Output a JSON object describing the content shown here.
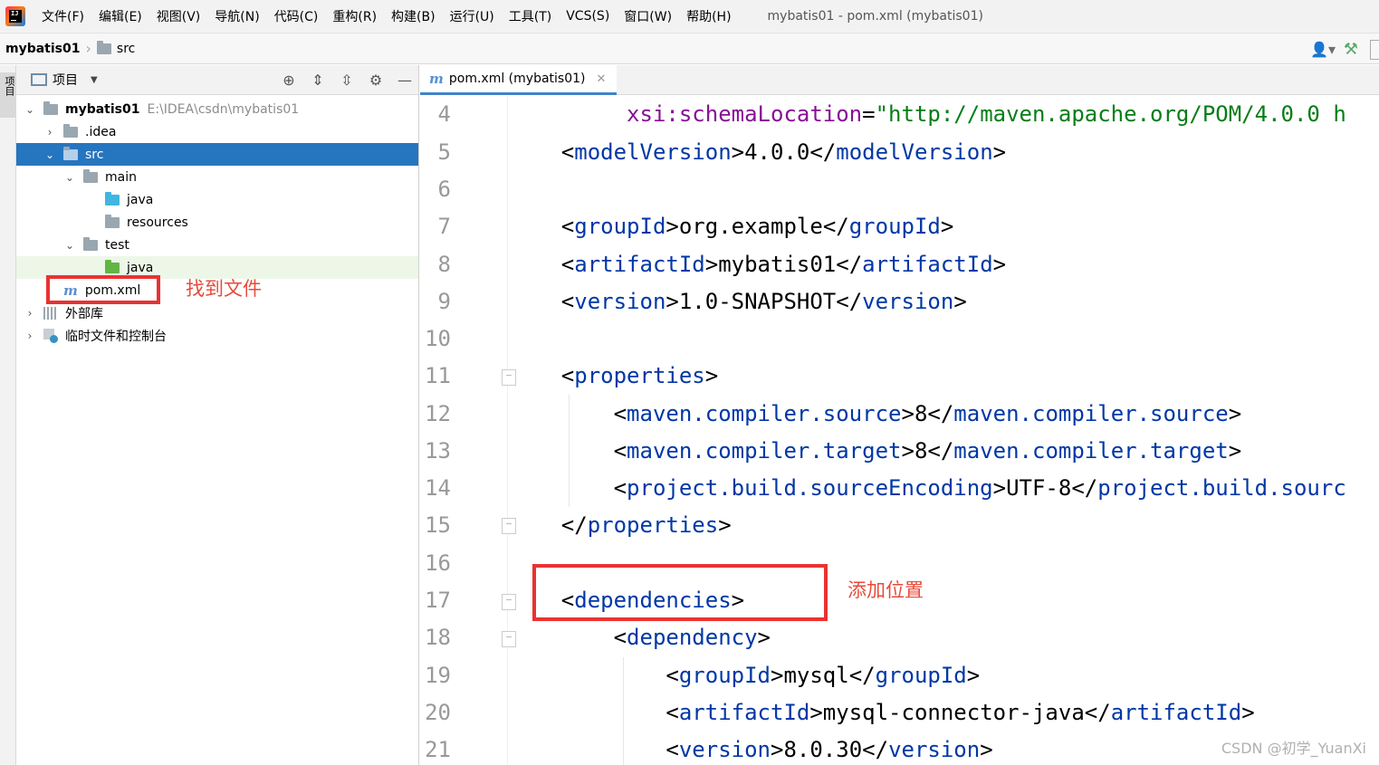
{
  "menubar": {
    "items": [
      "文件(F)",
      "编辑(E)",
      "视图(V)",
      "导航(N)",
      "代码(C)",
      "重构(R)",
      "构建(B)",
      "运行(U)",
      "工具(T)",
      "VCS(S)",
      "窗口(W)",
      "帮助(H)"
    ],
    "window_title": "mybatis01 - pom.xml (mybatis01)"
  },
  "navbar": {
    "project": "mybatis01",
    "folder": "src"
  },
  "left_stripe": {
    "tab_label": "项目"
  },
  "project_panel": {
    "title": "项目",
    "tree": [
      {
        "label": "mybatis01",
        "path": "E:\\IDEA\\csdn\\mybatis01"
      },
      {
        "label": ".idea"
      },
      {
        "label": "src"
      },
      {
        "label": "main"
      },
      {
        "label": "java"
      },
      {
        "label": "resources"
      },
      {
        "label": "test"
      },
      {
        "label": "java"
      },
      {
        "label": "pom.xml"
      },
      {
        "label": "外部库"
      },
      {
        "label": "临时文件和控制台"
      }
    ]
  },
  "annotations": {
    "find_file": "找到文件",
    "add_position": "添加位置"
  },
  "editor": {
    "tab_label": "pom.xml (mybatis01)",
    "lines": [
      {
        "n": "4"
      },
      {
        "n": "5"
      },
      {
        "n": "6"
      },
      {
        "n": "7"
      },
      {
        "n": "8"
      },
      {
        "n": "9"
      },
      {
        "n": "10"
      },
      {
        "n": "11"
      },
      {
        "n": "12"
      },
      {
        "n": "13"
      },
      {
        "n": "14"
      },
      {
        "n": "15"
      },
      {
        "n": "16"
      },
      {
        "n": "17"
      },
      {
        "n": "18"
      },
      {
        "n": "19"
      },
      {
        "n": "20"
      },
      {
        "n": "21"
      }
    ],
    "code": {
      "l4_attr": "xsi:schemaLocation",
      "l4_val": "\"http://maven.apache.org/POM/4.0.0 h",
      "l5_tag": "modelVersion",
      "l5_text": "4.0.0",
      "l7_tag": "groupId",
      "l7_text": "org.example",
      "l8_tag": "artifactId",
      "l8_text": "mybatis01",
      "l9_tag": "version",
      "l9_text": "1.0-SNAPSHOT",
      "l11_tag": "properties",
      "l12_tag": "maven.compiler.source",
      "l12_text": "8",
      "l13_tag": "maven.compiler.target",
      "l13_text": "8",
      "l14_tag": "project.build.sourceEncoding",
      "l14_text": "UTF-8",
      "l14_close": "project.build.sourc",
      "l15_tag": "properties",
      "l17_tag": "dependencies",
      "l18_tag": "dependency",
      "l19_tag": "groupId",
      "l19_text": "mysql",
      "l20_tag": "artifactId",
      "l20_text": "mysql-connector-java",
      "l21_tag": "version",
      "l21_text": "8.0.30"
    }
  },
  "watermark": "CSDN @初学_YuanXi",
  "colors": {
    "selection": "#2675bf",
    "tag": "#0037a6",
    "attr": "#871094",
    "string": "#067d17",
    "annotation": "#ea3232"
  }
}
